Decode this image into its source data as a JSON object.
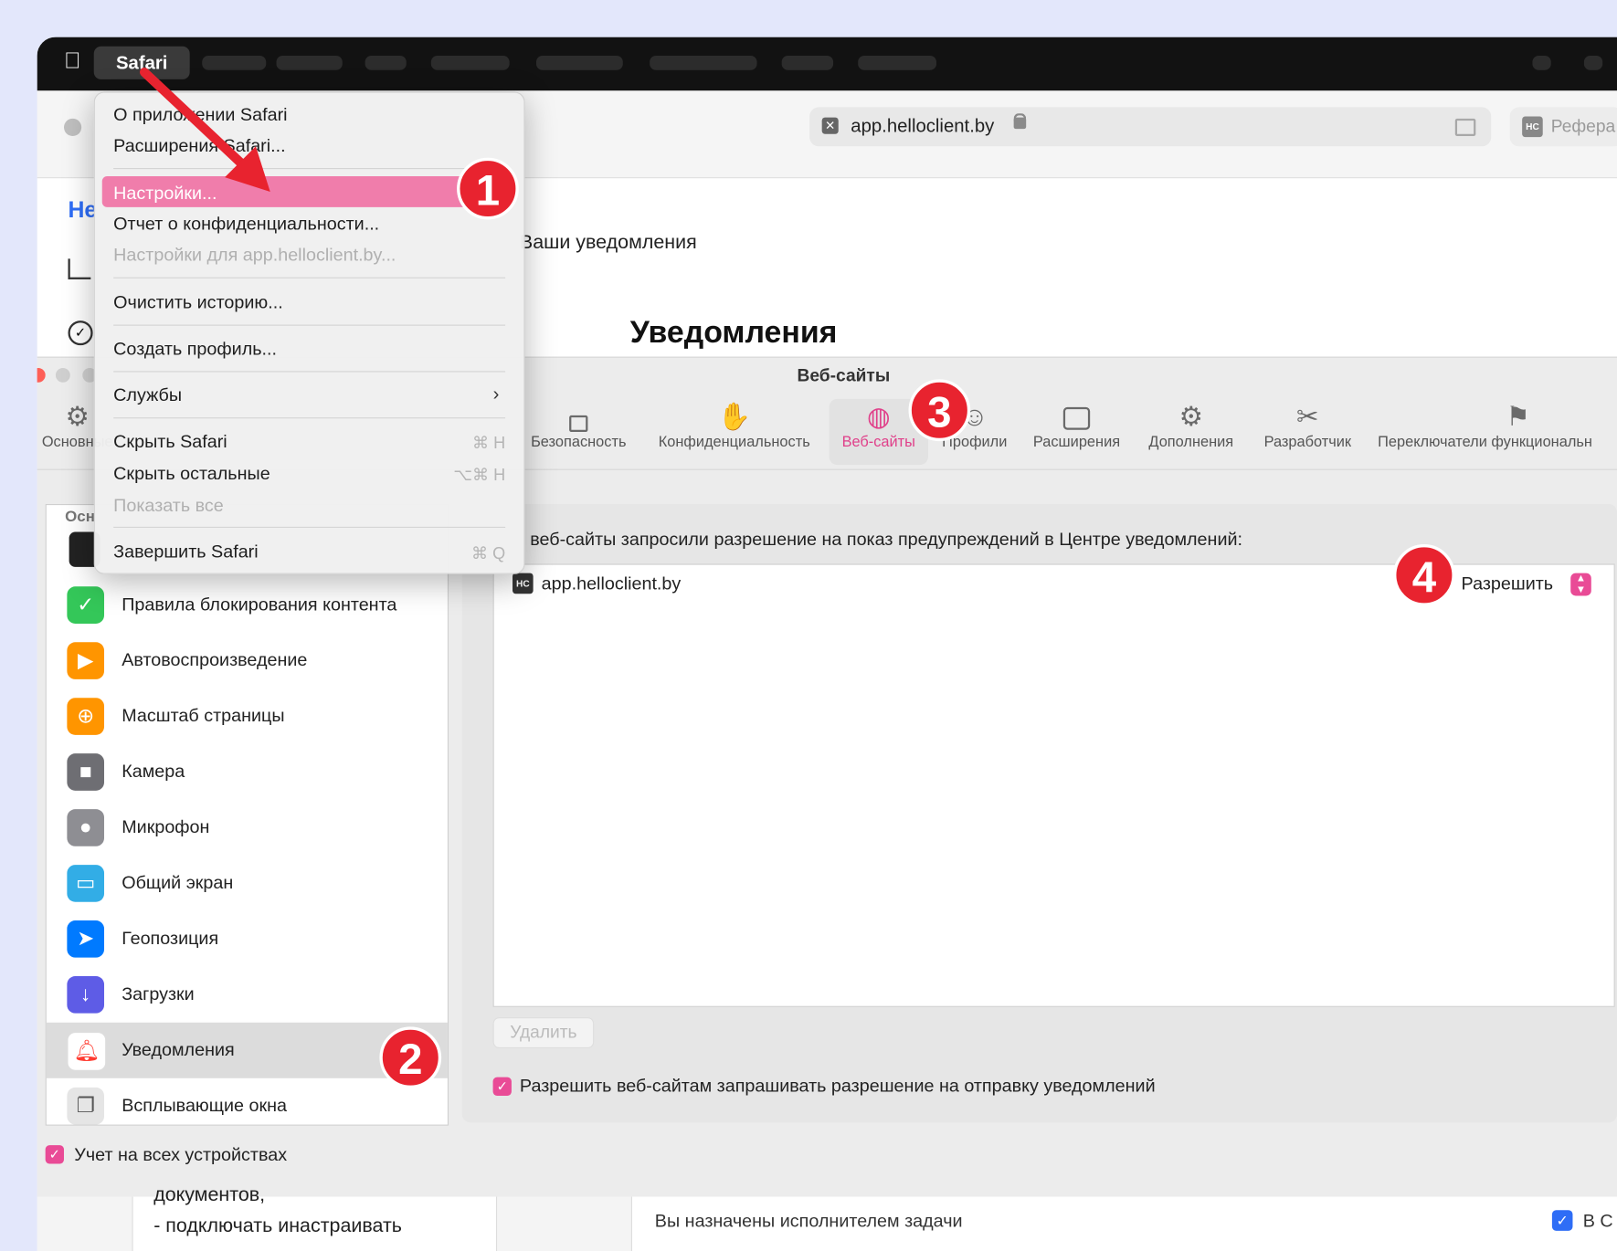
{
  "menubar": {
    "app_name": "Safari"
  },
  "browser": {
    "url": "app.helloclient.by",
    "right_tab": "Рефера",
    "favicon_text": "HC"
  },
  "background_page": {
    "sidebar_logo": "He",
    "breadcrumb": "Ваши уведомления",
    "heading": "Уведомления"
  },
  "safari_menu": {
    "items": [
      {
        "label": "О приложении Safari",
        "shortcut": "",
        "disabled": false
      },
      {
        "label": "Расширения Safari...",
        "shortcut": "",
        "disabled": false
      },
      {
        "label": "Настройки...",
        "shortcut": "",
        "disabled": false,
        "highlighted": true
      },
      {
        "label": "Отчет о конфиденциальности...",
        "shortcut": "",
        "disabled": false
      },
      {
        "label": "Настройки для app.helloclient.by...",
        "shortcut": "",
        "disabled": true
      },
      {
        "label": "Очистить историю...",
        "shortcut": "",
        "disabled": false
      },
      {
        "label": "Создать профиль...",
        "shortcut": "",
        "disabled": false
      },
      {
        "label": "Службы",
        "shortcut": "",
        "disabled": false
      },
      {
        "label": "Скрыть Safari",
        "shortcut": "⌘ H",
        "disabled": false
      },
      {
        "label": "Скрыть остальные",
        "shortcut": "⌥⌘ H",
        "disabled": false
      },
      {
        "label": "Показать все",
        "shortcut": "",
        "disabled": true
      },
      {
        "label": "Завершить Safari",
        "shortcut": "⌘ Q",
        "disabled": false
      }
    ]
  },
  "settings": {
    "title": "Веб-сайты",
    "tabs": [
      {
        "label": "Основные",
        "icon": "gear-icon"
      },
      {
        "label": "Безопасность",
        "icon": "lock-icon"
      },
      {
        "label": "Конфиденциальность",
        "icon": "hand-icon"
      },
      {
        "label": "Веб-сайты",
        "icon": "globe-icon",
        "active": true
      },
      {
        "label": "Профили",
        "icon": "person-icon"
      },
      {
        "label": "Расширения",
        "icon": "puzzle-icon"
      },
      {
        "label": "Дополнения",
        "icon": "gears-icon"
      },
      {
        "label": "Разработчик",
        "icon": "tools-icon"
      },
      {
        "label": "Переключатели функциональн",
        "icon": "flags-icon"
      }
    ],
    "sidebar_header": "Осн",
    "sidebar_items": [
      {
        "label": "Правила блокирования контента",
        "icon": "shield-check-icon",
        "color": "#34c759"
      },
      {
        "label": "Автовоспроизведение",
        "icon": "play-icon",
        "color": "#ff9500"
      },
      {
        "label": "Масштаб страницы",
        "icon": "zoom-icon",
        "color": "#ff9500"
      },
      {
        "label": "Камера",
        "icon": "camera-icon",
        "color": "#6e6e73"
      },
      {
        "label": "Микрофон",
        "icon": "microphone-icon",
        "color": "#8e8e93"
      },
      {
        "label": "Общий экран",
        "icon": "screen-share-icon",
        "color": "#32ade6"
      },
      {
        "label": "Геопозиция",
        "icon": "location-icon",
        "color": "#007aff"
      },
      {
        "label": "Загрузки",
        "icon": "download-icon",
        "color": "#5e5ce6"
      },
      {
        "label": "Уведомления",
        "icon": "bell-icon",
        "color": "#ff3b30",
        "selected": true
      },
      {
        "label": "Всплывающие окна",
        "icon": "popup-icon",
        "color": "#8e8e93"
      }
    ],
    "sync_checkbox": "Учет на всех устройствах",
    "panel_heading": "веб-сайты запросили разрешение на показ предупреждений в Центре уведомлений:",
    "site": {
      "name": "app.helloclient.by",
      "permission": "Разрешить"
    },
    "delete_button": "Удалить",
    "allow_checkbox": "Разрешить веб-сайтам запрашивать разрешение на отправку уведомлений"
  },
  "bottom": {
    "left_text_1": "документов,",
    "left_text_2": "- подключать инастраивать",
    "task_text": "Вы назначены исполнителем задачи",
    "right_text": "В С"
  },
  "badges": [
    "1",
    "2",
    "3",
    "4"
  ],
  "accent_color": "#e94b96"
}
